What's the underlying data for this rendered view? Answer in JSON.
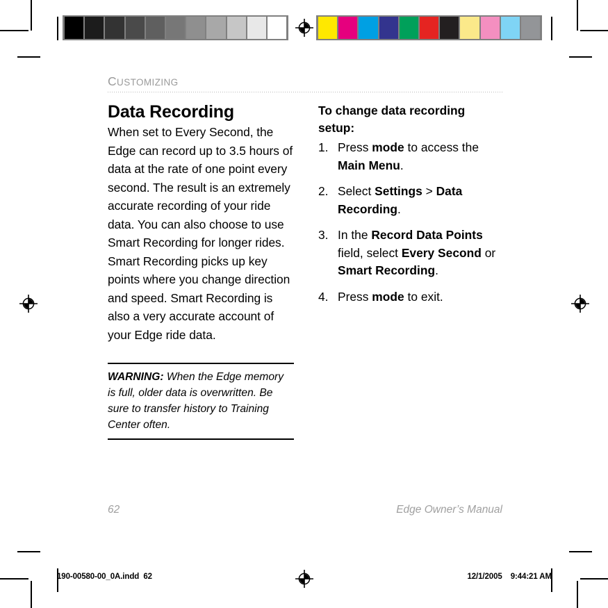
{
  "document": {
    "running_head": "Customizing",
    "running_head_first": "C",
    "running_head_rest": "USTOMIZING"
  },
  "left_column": {
    "title": "Data Recording",
    "body": "When set to Every Second, the Edge can record up to 3.5 hours of data at the rate of one point every second. The result is an extremely accurate recording of your ride data. You can also choose to use Smart Recording for longer rides. Smart Recording picks up key points where you change direction and speed. Smart Recording is also a very accurate account of your Edge ride data.",
    "note": {
      "lead": "WARNING:",
      "text": " When the Edge memory is full, older data is overwritten. Be sure to transfer history to Training Center often."
    }
  },
  "right_column": {
    "procedure_title": "To change data recording setup:",
    "steps": [
      {
        "num": "1.",
        "segments": [
          {
            "text": "Press ",
            "bold": false
          },
          {
            "text": "mode",
            "bold": true
          },
          {
            "text": " to access the ",
            "bold": false
          },
          {
            "text": "Main Menu",
            "bold": true
          },
          {
            "text": ".",
            "bold": false
          }
        ]
      },
      {
        "num": "2.",
        "segments": [
          {
            "text": "Select ",
            "bold": false
          },
          {
            "text": "Settings",
            "bold": true
          },
          {
            "text": " > ",
            "bold": false
          },
          {
            "text": "Data Recording",
            "bold": true
          },
          {
            "text": ".",
            "bold": false
          }
        ]
      },
      {
        "num": "3.",
        "segments": [
          {
            "text": "In the ",
            "bold": false
          },
          {
            "text": "Record Data Points",
            "bold": true
          },
          {
            "text": " field, select ",
            "bold": false
          },
          {
            "text": "Every Second",
            "bold": true
          },
          {
            "text": " or ",
            "bold": false
          },
          {
            "text": "Smart Recording",
            "bold": true
          },
          {
            "text": ".",
            "bold": false
          }
        ]
      },
      {
        "num": "4.",
        "segments": [
          {
            "text": "Press ",
            "bold": false
          },
          {
            "text": "mode",
            "bold": true
          },
          {
            "text": " to exit.",
            "bold": false
          }
        ]
      }
    ]
  },
  "page_footer": {
    "page_number": "62",
    "manual_title": "Edge Owner’s Manual"
  },
  "slug_line": {
    "file_name": "190-00580-00_0A.indd",
    "page": "62",
    "date": "12/1/2005",
    "time": "9:44:21 AM"
  },
  "calibration": {
    "grayscale_label": "grayscale-step-wedge",
    "grayscale_patches": [
      "#000000",
      "#1c1c1c",
      "#333333",
      "#4a4a4a",
      "#5f5f5f",
      "#777777",
      "#8f8f8f",
      "#a8a8a8",
      "#c6c6c6",
      "#e8e8e8",
      "#ffffff"
    ],
    "color_label": "color-control-patches",
    "color_patches": [
      "#ffe800",
      "#e6007e",
      "#00a0e3",
      "#33348e",
      "#00a05a",
      "#e52421",
      "#231f20",
      "#fbe98a",
      "#f48fc0",
      "#7fd4f5",
      "#939598"
    ]
  },
  "marks": {
    "registration_icon": "registration-target-icon",
    "crop_mark": "crop-mark"
  }
}
